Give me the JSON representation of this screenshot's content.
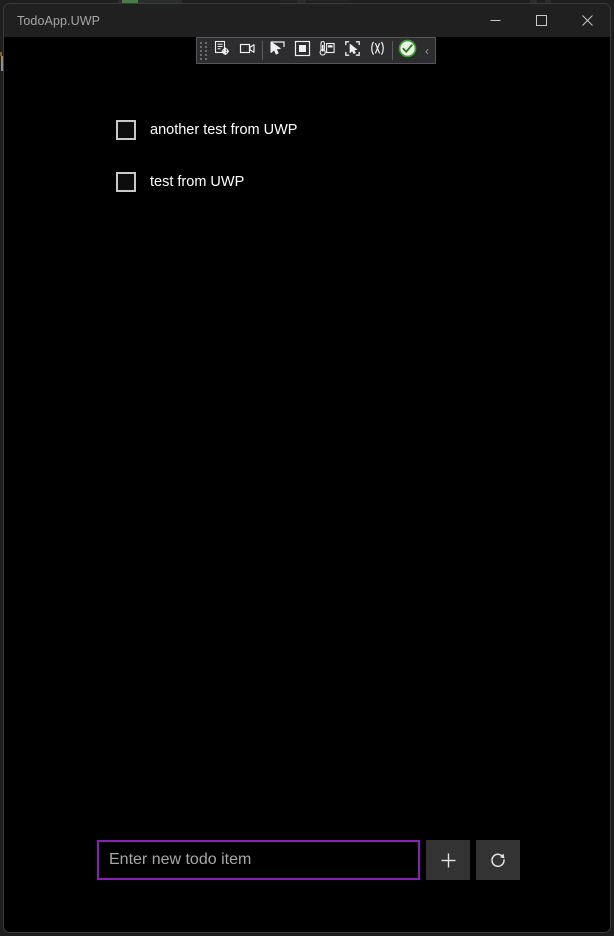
{
  "window": {
    "title": "TodoApp.UWP",
    "caption_buttons": [
      {
        "name": "minimize",
        "label": "Minimize"
      },
      {
        "name": "maximize",
        "label": "Maximize"
      },
      {
        "name": "close",
        "label": "Close"
      }
    ]
  },
  "xaml_toolbar": {
    "title": "XAML in-app toolbar",
    "buttons": [
      {
        "name": "go-to-live-visual-tree",
        "label": "Go to Live Visual Tree"
      },
      {
        "name": "enable-selection",
        "label": "Enable selection"
      },
      {
        "name": "select-element",
        "label": "Select element"
      },
      {
        "name": "display-layout-adorners",
        "label": "Display layout adorners"
      },
      {
        "name": "track-focused-element",
        "label": "Track focused element"
      },
      {
        "name": "show-in-live-visual-tree",
        "label": "Show in Live Visual Tree"
      },
      {
        "name": "xaml-hot-reload",
        "label": "XAML Hot Reload"
      },
      {
        "name": "hot-reload-status",
        "label": "Hot Reload succeeded"
      }
    ],
    "collapse_label": "‹"
  },
  "todos": [
    {
      "label": "another test from UWP",
      "checked": false
    },
    {
      "label": "test from UWP",
      "checked": false
    }
  ],
  "entry": {
    "placeholder": "Enter new todo item",
    "value": "",
    "add_label": "Add todo item",
    "refresh_label": "Refresh list",
    "focus_color": "#8a1fb8"
  }
}
